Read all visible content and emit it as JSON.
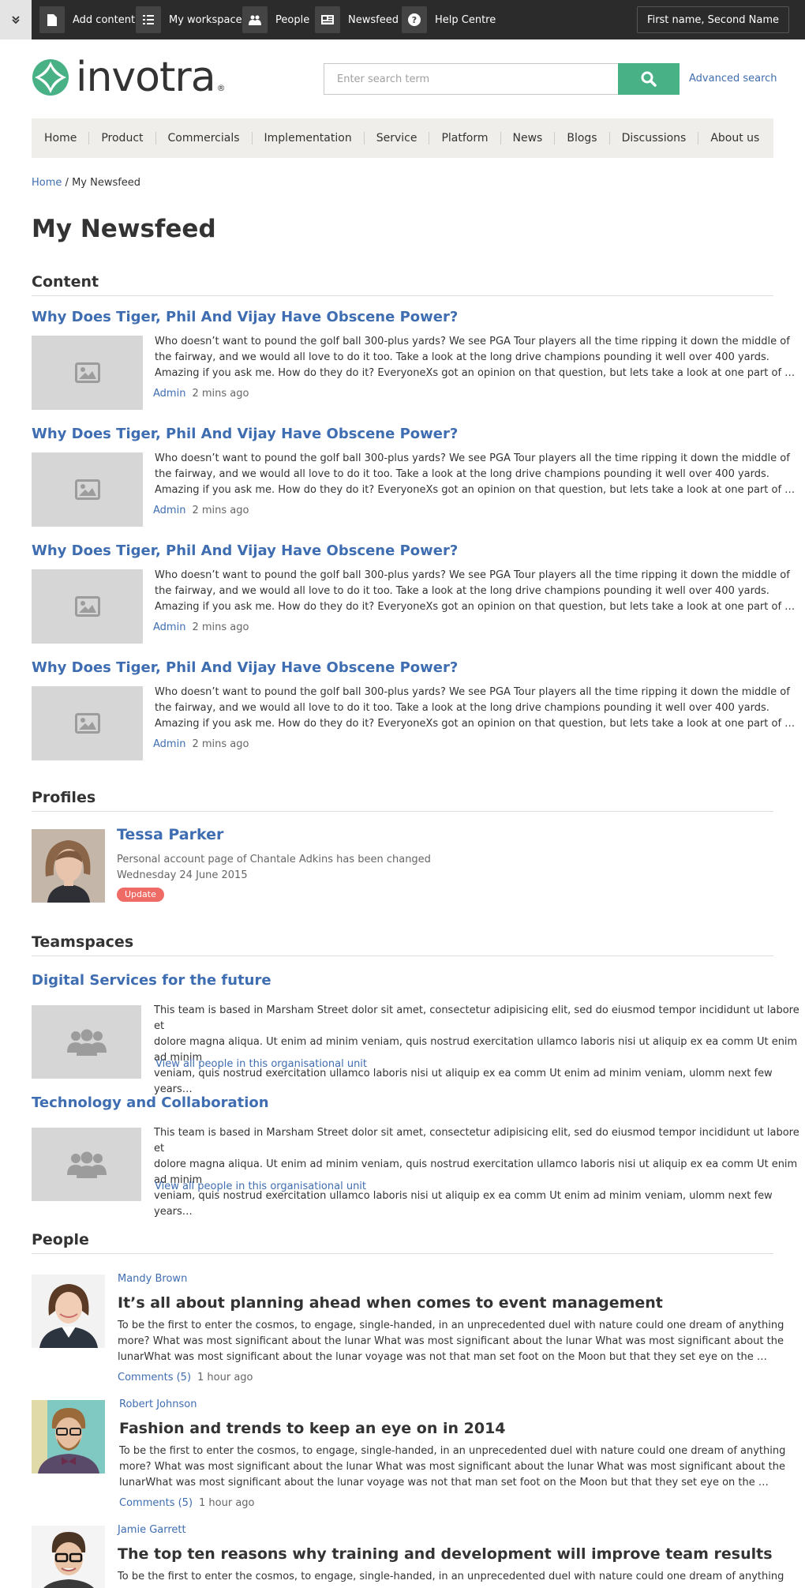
{
  "topbar": {
    "items": [
      {
        "label": "Add content",
        "icon": "document-icon"
      },
      {
        "label": "My workspace",
        "icon": "list-icon"
      },
      {
        "label": "People",
        "icon": "people-icon"
      },
      {
        "label": "Newsfeed",
        "icon": "newsfeed-icon"
      },
      {
        "label": "Help Centre",
        "icon": "help-icon"
      }
    ],
    "user": "First name, Second Name"
  },
  "header": {
    "logo_text": "invotra",
    "search_placeholder": "Enter search term",
    "advanced_search": "Advanced search",
    "accent_color": "#49b186"
  },
  "nav": [
    "Home",
    "Product",
    "Commercials",
    "Implementation",
    "Service",
    "Platform",
    "News",
    "Blogs",
    "Discussions",
    "About us"
  ],
  "breadcrumb": {
    "home": "Home",
    "separator": "/",
    "current": "My Newsfeed"
  },
  "page_title": "My Newsfeed",
  "content": {
    "heading": "Content",
    "items": [
      {
        "title": "Why Does Tiger, Phil And Vijay Have Obscene Power?",
        "lines": [
          "Who doesn’t want to pound the golf ball 300-plus yards? We see PGA Tour players all the time ripping it down the middle of",
          "the fairway, and we would all love to do it too. Take a look at the long drive champions pounding it well over 400 yards.",
          "Amazing if you ask me. How do they do it? EveryoneXs got an opinion on that question, but lets take a look at one part of …"
        ],
        "author": "Admin",
        "time": "2 mins ago"
      },
      {
        "title": "Why Does Tiger, Phil And Vijay Have Obscene Power?",
        "lines": [
          "Who doesn’t want to pound the golf ball 300-plus yards? We see PGA Tour players all the time ripping it down the middle of",
          "the fairway, and we would all love to do it too. Take a look at the long drive champions pounding it well over 400 yards.",
          "Amazing if you ask me. How do they do it? EveryoneXs got an opinion on that question, but lets take a look at one part of …"
        ],
        "author": "Admin",
        "time": "2 mins ago"
      },
      {
        "title": "Why Does Tiger, Phil And Vijay Have Obscene Power?",
        "lines": [
          "Who doesn’t want to pound the golf ball 300-plus yards? We see PGA Tour players all the time ripping it down the middle of",
          "the fairway, and we would all love to do it too. Take a look at the long drive champions pounding it well over 400 yards.",
          "Amazing if you ask me. How do they do it? EveryoneXs got an opinion on that question, but lets take a look at one part of …"
        ],
        "author": "Admin",
        "time": "2 mins ago"
      },
      {
        "title": "Why Does Tiger, Phil And Vijay Have Obscene Power?",
        "lines": [
          "Who doesn’t want to pound the golf ball 300-plus yards? We see PGA Tour players all the time ripping it down the middle of",
          "the fairway, and we would all love to do it too. Take a look at the long drive champions pounding it well over 400 yards.",
          "Amazing if you ask me. How do they do it? EveryoneXs got an opinion on that question, but lets take a look at one part of …"
        ],
        "author": "Admin",
        "time": "2 mins ago"
      }
    ]
  },
  "profiles": {
    "heading": "Profiles",
    "items": [
      {
        "name": "Tessa Parker",
        "text": "Personal account page of Chantale Adkins has been changed",
        "date": "Wednesday 24 June 2015",
        "badge": "Update"
      }
    ]
  },
  "teamspaces": {
    "heading": "Teamspaces",
    "items": [
      {
        "title": "Digital Services for the future",
        "lines": [
          "This team is based in Marsham Street dolor sit amet, consectetur adipisicing elit, sed do eiusmod tempor incididunt ut labore et",
          "dolore magna aliqua. Ut enim ad minim veniam, quis nostrud exercitation ullamco laboris nisi ut aliquip ex ea comm Ut enim ad minim",
          "veniam, quis nostrud exercitation ullamco laboris nisi ut aliquip ex ea comm Ut enim ad minim veniam,  ulomm  next few years…"
        ],
        "link": "View all people in this organisational unit"
      },
      {
        "title": "Technology and Collaboration",
        "lines": [
          "This team is based in Marsham Street dolor sit amet, consectetur adipisicing elit, sed do eiusmod tempor incididunt ut labore et",
          "dolore magna aliqua. Ut enim ad minim veniam, quis nostrud exercitation ullamco laboris nisi ut aliquip ex ea comm Ut enim ad minim",
          "veniam, quis nostrud exercitation ullamco laboris nisi ut aliquip ex ea comm Ut enim ad minim veniam,  ulomm  next few years…"
        ],
        "link": "View all people in this organisational unit"
      }
    ]
  },
  "people": {
    "heading": "People",
    "items": [
      {
        "author": "Mandy Brown",
        "title": "It’s all about planning ahead when comes to event management",
        "lines": [
          "To be the first to enter the cosmos, to engage, single-handed, in an unprecedented duel with nature could one dream of anything",
          "more?  What was most significant about the lunar What was most significant about the lunar What was most significant about the",
          "lunarWhat was most significant about the lunar voyage was not that man set foot on the Moon but that they set eye on the …"
        ],
        "comments": "Comments (5)",
        "time": "1 hour ago"
      },
      {
        "author": "Robert Johnson",
        "title": "Fashion and trends to keep an eye on in 2014",
        "lines": [
          "To be the first to enter the cosmos, to engage, single-handed, in an unprecedented duel with nature could one dream of anything",
          "more?  What was most significant about the lunar What was most significant about the lunar What was most significant about the",
          "lunarWhat was most significant about the lunar voyage was not that man set foot on the Moon but that they set eye on the …"
        ],
        "comments": "Comments (5)",
        "time": "1 hour ago"
      },
      {
        "author": "Jamie Garrett",
        "title": "The top ten reasons why training and development will improve team results",
        "lines": [
          "To be the first to enter the cosmos, to engage, single-handed, in an unprecedented duel with nature could one dream of anything"
        ],
        "comments": "",
        "time": ""
      }
    ]
  }
}
